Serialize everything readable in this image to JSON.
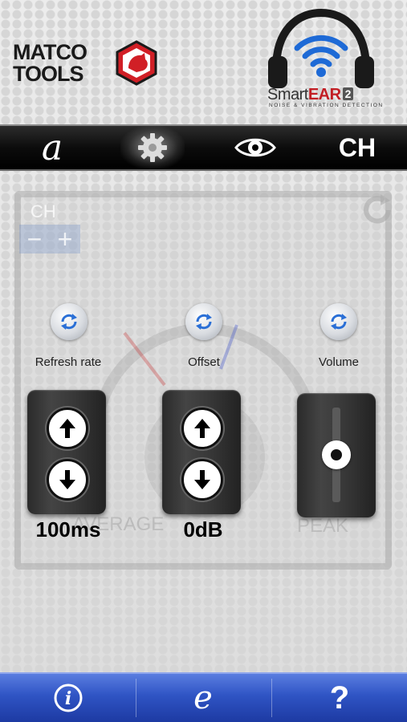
{
  "brand": {
    "matco_line1": "MATCO",
    "matco_line2": "TOOLS",
    "product_name_prefix": "Smart",
    "product_name_suffix": "EAR",
    "product_version": "2",
    "product_tagline": "NOISE & VIBRATION DETECTION"
  },
  "tabs": {
    "a_label": "a",
    "ch_label": "CH"
  },
  "background_panel": {
    "ch_label": "CH",
    "minus": "−",
    "plus": "+",
    "average_label": "AVERAGE",
    "peak_label": "PEAK"
  },
  "controls": {
    "refresh_rate": {
      "label": "Refresh rate",
      "value": "100ms"
    },
    "offset": {
      "label": "Offset",
      "value": "0dB"
    },
    "volume": {
      "label": "Volume",
      "level": 0.5
    }
  },
  "bottom_bar": {
    "info_label": "i",
    "e_label": "e",
    "help_label": "?"
  },
  "colors": {
    "tab_bar": "#000000",
    "bottom_bar": "#2f54c4",
    "brand_red": "#c21e24",
    "wifi_blue": "#1e6ad6"
  }
}
